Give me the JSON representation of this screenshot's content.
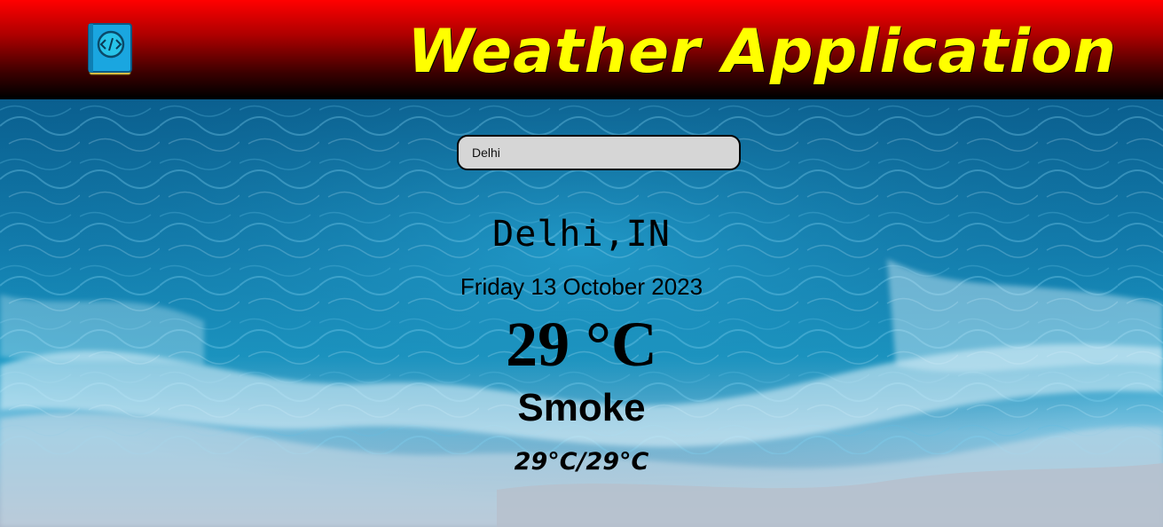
{
  "header": {
    "title": "Weather Application",
    "logo_icon": "book-code-icon",
    "gradient_colors": [
      "#ff0000",
      "#000000"
    ],
    "title_color": "#ffff00"
  },
  "search": {
    "value": "Delhi"
  },
  "weather": {
    "location": "Delhi,IN",
    "date": "Friday 13 October 2023",
    "temperature": "29 °C",
    "condition": "Smoke",
    "min_max": "29°C/29°C"
  },
  "background": {
    "description_colors": [
      "#0a5a8a",
      "#1a8fc0",
      "#cfe6f2",
      "#9fb0c4"
    ]
  }
}
